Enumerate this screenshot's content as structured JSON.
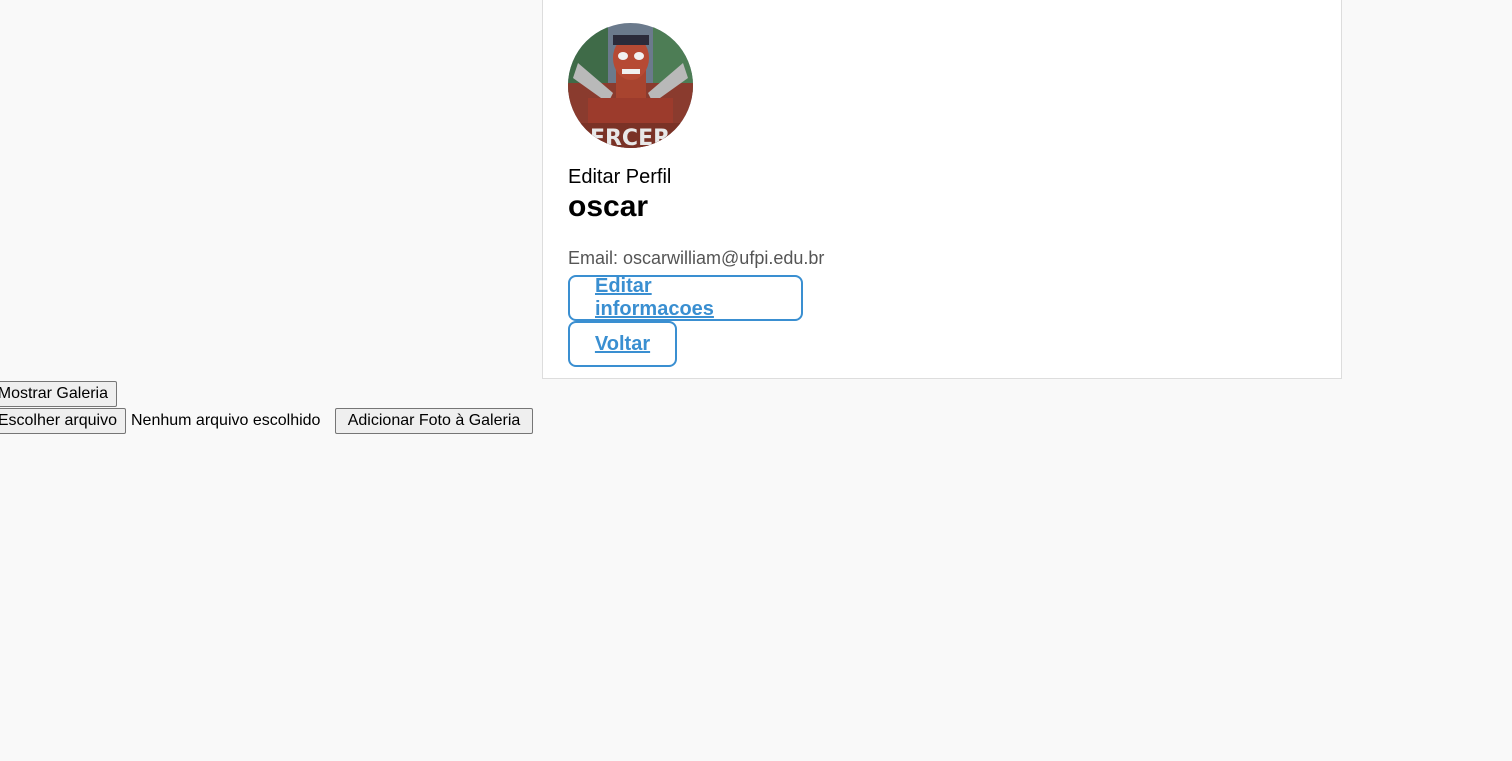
{
  "profile": {
    "edit_profile_label": "Editar Perfil",
    "username": "oscar",
    "email_prefix": "Email: ",
    "email": "oscarwilliam@ufpi.edu.br",
    "avatar_watermark": "ERCER",
    "edit_info_label": "Editar informacoes",
    "back_label": "Voltar"
  },
  "gallery": {
    "show_gallery_label": "Mostrar Galeria",
    "choose_file_label": "Escolher arquivo",
    "no_file_text": "Nenhum arquivo escolhido",
    "add_photo_label": "Adicionar Foto à Galeria"
  },
  "colors": {
    "accent": "#3a8fd1",
    "background": "#f9f9f9",
    "card": "#ffffff"
  }
}
